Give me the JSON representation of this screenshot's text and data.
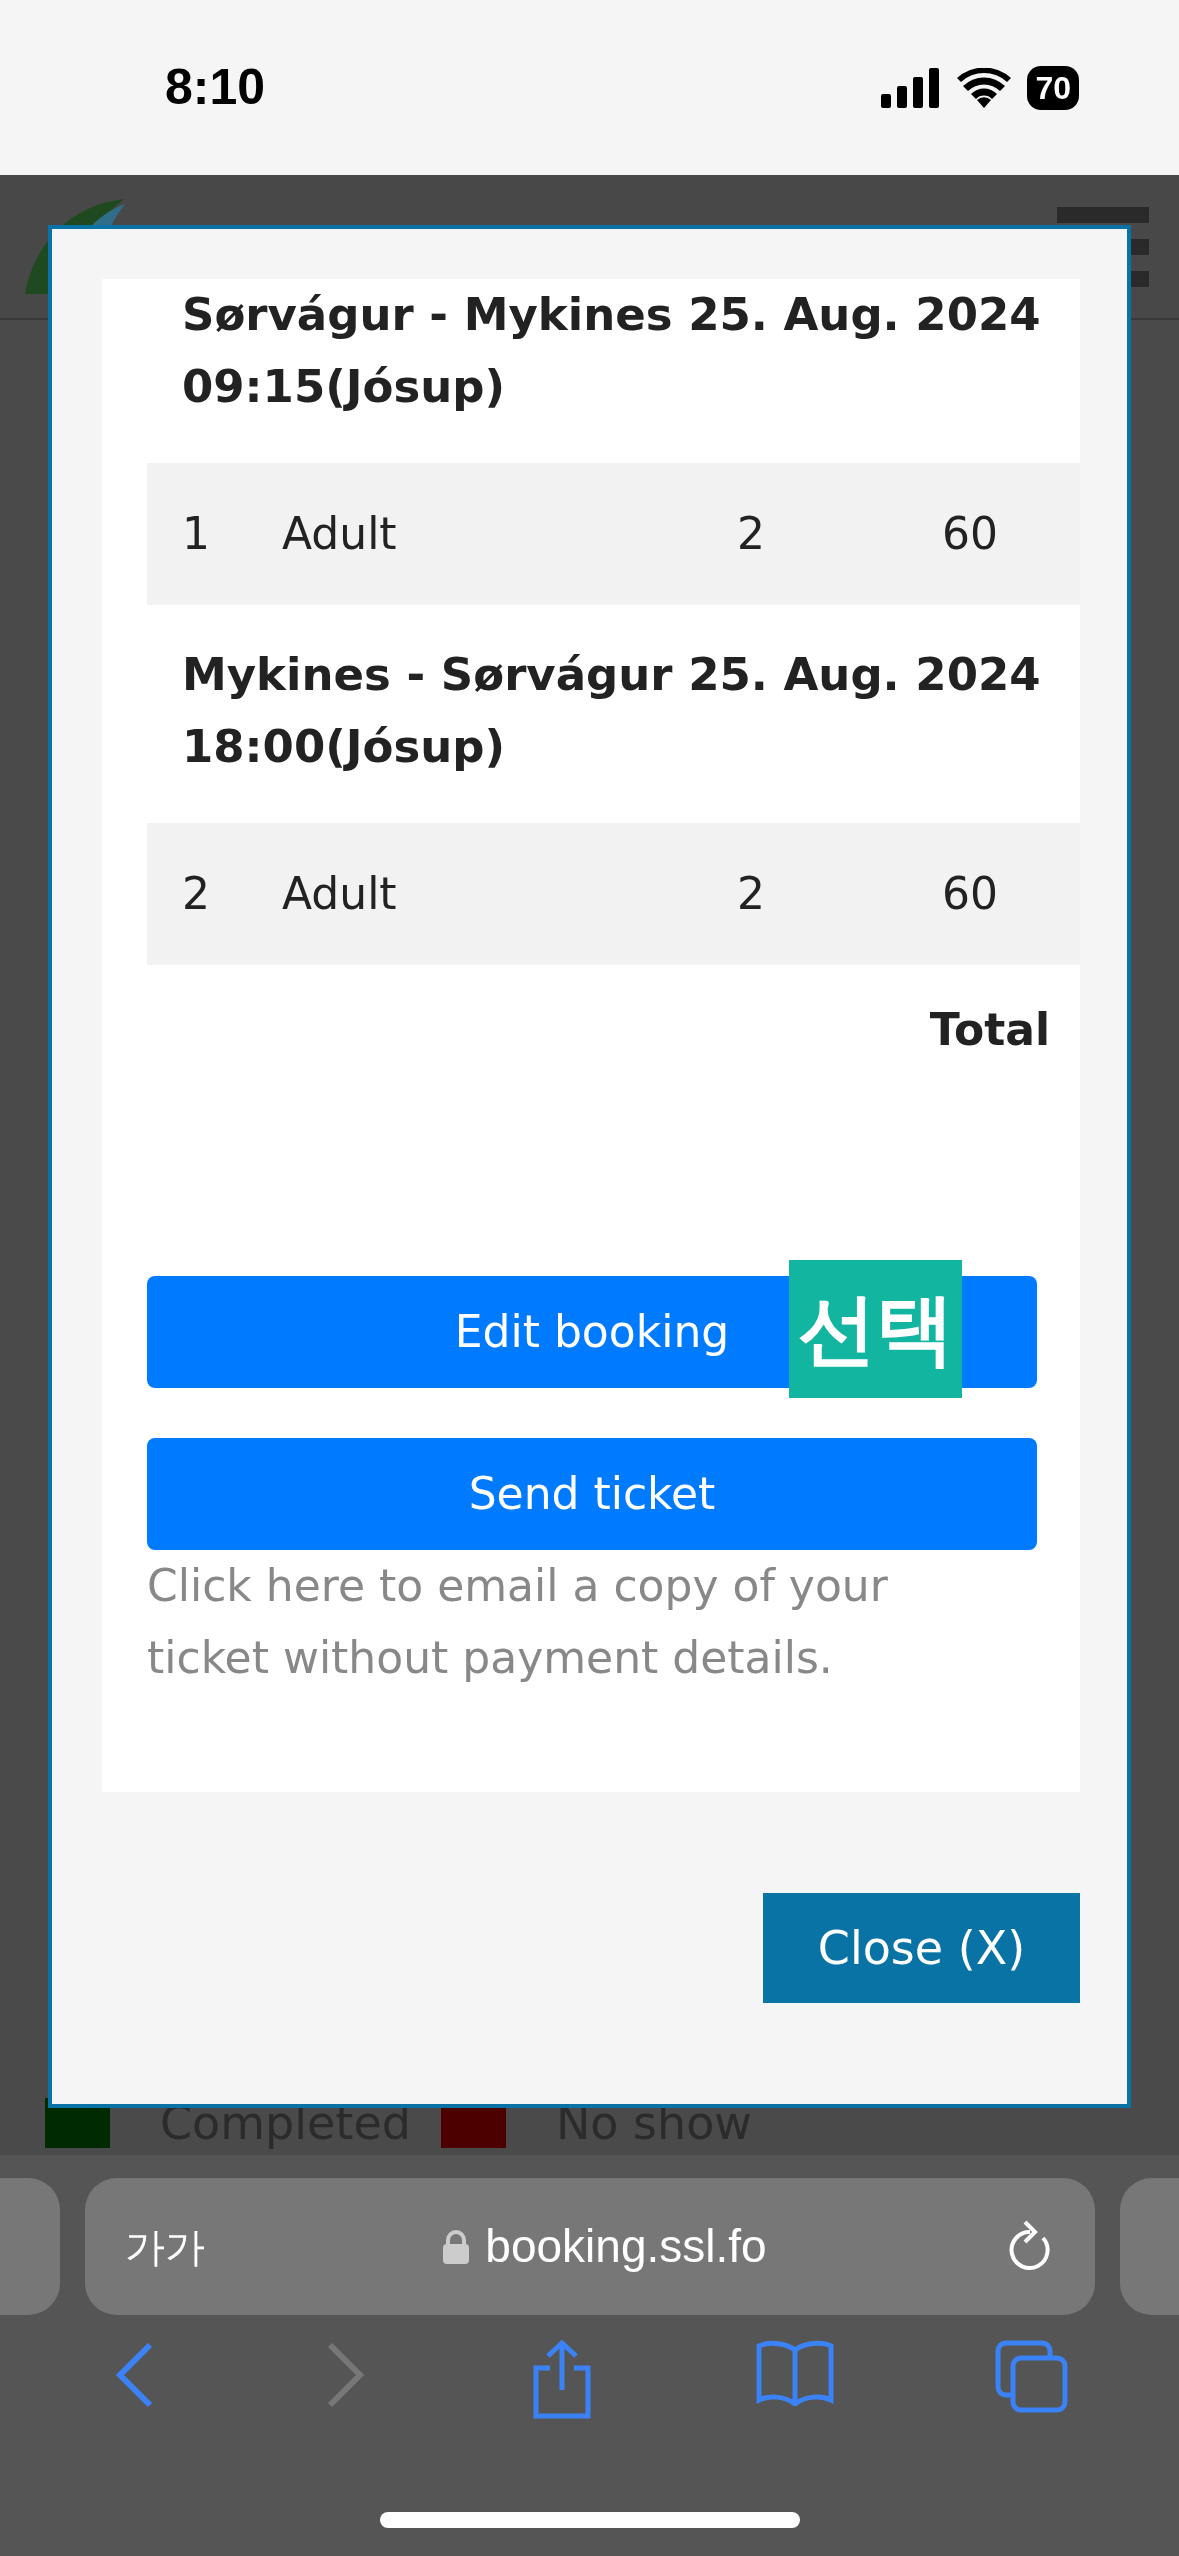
{
  "status_bar": {
    "time": "8:10",
    "battery": "70"
  },
  "modal": {
    "trips": [
      {
        "title": "Sørvágur - Mykines 25. Aug. 2024",
        "time": "09:15(Jósup)",
        "rows": [
          {
            "number": "1",
            "type": "Adult",
            "quantity": "2",
            "price": "60"
          }
        ]
      },
      {
        "title": "Mykines - Sørvágur 25. Aug. 2024",
        "time": "18:00(Jósup)",
        "rows": [
          {
            "number": "2",
            "type": "Adult",
            "quantity": "2",
            "price": "60"
          }
        ]
      }
    ],
    "total_label": "Total",
    "buttons": [
      {
        "label": "Edit booking"
      },
      {
        "label": "Send ticket"
      }
    ],
    "overlay_tag": "선택",
    "note": "Click here to email a copy of your ticket without payment details.",
    "close_button": "Close (X)"
  },
  "legend": [
    {
      "label": "Completed",
      "color": "#002a00"
    },
    {
      "label": "No show",
      "color": "#4d0000"
    }
  ],
  "browser": {
    "text_size_button": "가가",
    "url": "booking.ssl.fo"
  }
}
